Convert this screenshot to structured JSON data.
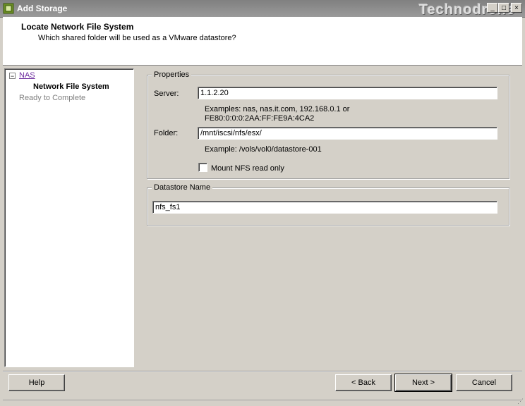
{
  "window": {
    "title": "Add Storage",
    "watermark": "Technodrone",
    "minimize": "_",
    "maximize": "□",
    "close": "×"
  },
  "header": {
    "title": "Locate Network File System",
    "subtitle": "Which shared folder will be used as a VMware datastore?"
  },
  "nav": {
    "toggle": "−",
    "items": [
      {
        "label": "NAS"
      },
      {
        "label": "Network File System"
      },
      {
        "label": "Ready to Complete"
      }
    ]
  },
  "properties": {
    "legend": "Properties",
    "server_label": "Server:",
    "server_value": "1.1.2.20",
    "server_example_1": "Examples: nas, nas.it.com, 192.168.0.1 or",
    "server_example_2": "FE80:0:0:0:2AA:FF:FE9A:4CA2",
    "folder_label": "Folder:",
    "folder_value": "/mnt/iscsi/nfs/esx/",
    "folder_example": "Example: /vols/vol0/datastore-001",
    "mount_readonly_label": "Mount NFS read only"
  },
  "datastore": {
    "legend": "Datastore Name",
    "value": "nfs_fs1"
  },
  "buttons": {
    "help": "Help",
    "back": "< Back",
    "next": "Next >",
    "cancel": "Cancel"
  },
  "colors": {
    "dialog_bg": "#d4d0c8",
    "link_visited": "#7030a0"
  }
}
